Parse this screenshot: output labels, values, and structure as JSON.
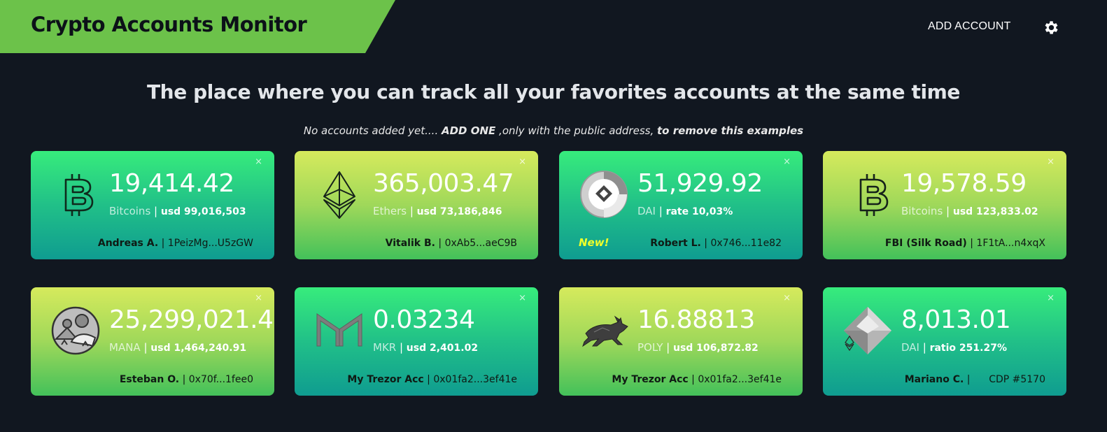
{
  "header": {
    "title": "Crypto Accounts Monitor",
    "add_account_label": "ADD ACCOUNT",
    "settings_icon": "gear-icon"
  },
  "hero": {
    "headline": "The place where you can track all your favorites accounts at the same time",
    "sub_prefix": "No accounts added yet.... ",
    "sub_add": "ADD ONE",
    "sub_middle": " ,only with the public address, ",
    "sub_suffix": "to remove this examples"
  },
  "colors": {
    "brand_green": "#6cc24a",
    "background": "#111720",
    "card_green_top": "#37ec7c",
    "card_teal_bottom": "#0f9c90",
    "card_yellow_top": "#d6ea5c",
    "new_badge": "#f0ff2a"
  },
  "cards": [
    {
      "icon": "bitcoin-icon",
      "amount": "19,414.42",
      "unit": "Bitcoins",
      "sep": " | ",
      "value": "usd 99,016,503",
      "owner": "Andreas A.",
      "owner_sep": " | ",
      "address": "1PeizMg...U5zGW",
      "close": "×"
    },
    {
      "icon": "ethereum-icon",
      "amount": "365,003.47",
      "unit": "Ethers",
      "sep": " | ",
      "value": "usd 73,186,846",
      "owner": "Vitalik B.",
      "owner_sep": " | ",
      "address": "0xAb5...aeC9B",
      "close": "×"
    },
    {
      "icon": "dai-savings-icon",
      "amount": "51,929.92",
      "unit": "DAI",
      "sep": " | ",
      "value": "rate 10,03%",
      "owner": "Robert L.",
      "owner_sep": " | ",
      "address": "0x746...11e82",
      "badge": "New!",
      "close": "×"
    },
    {
      "icon": "bitcoin-icon",
      "amount": "19,578.59",
      "unit": "Bitcoins",
      "sep": " | ",
      "value": "usd 123,833.02",
      "owner": "FBI (Silk Road)",
      "owner_sep": " | ",
      "address": "1F1tA...n4xqX",
      "close": "×"
    },
    {
      "icon": "decentraland-icon",
      "amount": "25,299,021.4",
      "unit": "MANA",
      "sep": " | ",
      "value": "usd 1,464,240.91",
      "owner": "Esteban O.",
      "owner_sep": " | ",
      "address": "0x70f...1fee0",
      "close": "×"
    },
    {
      "icon": "maker-icon",
      "amount": "0.03234",
      "unit": "MKR",
      "sep": " | ",
      "value": "usd 2,401.02",
      "owner": "My Trezor Acc",
      "owner_sep": " | ",
      "address": "0x01fa2...3ef41e",
      "close": "×"
    },
    {
      "icon": "polymath-bull-icon",
      "amount": "16.88813",
      "unit": "POLY",
      "sep": " | ",
      "value": "usd 106,872.82",
      "owner": "My Trezor Acc",
      "owner_sep": " | ",
      "address": "0x01fa2...3ef41e",
      "close": "×"
    },
    {
      "icon": "cdp-diamond-icon",
      "amount": "8,013.01",
      "unit": "DAI",
      "sep": " | ",
      "value": "ratio 251.27%",
      "owner": "Mariano C.",
      "owner_sep": " |      ",
      "address": "CDP #5170",
      "close": "×"
    }
  ]
}
